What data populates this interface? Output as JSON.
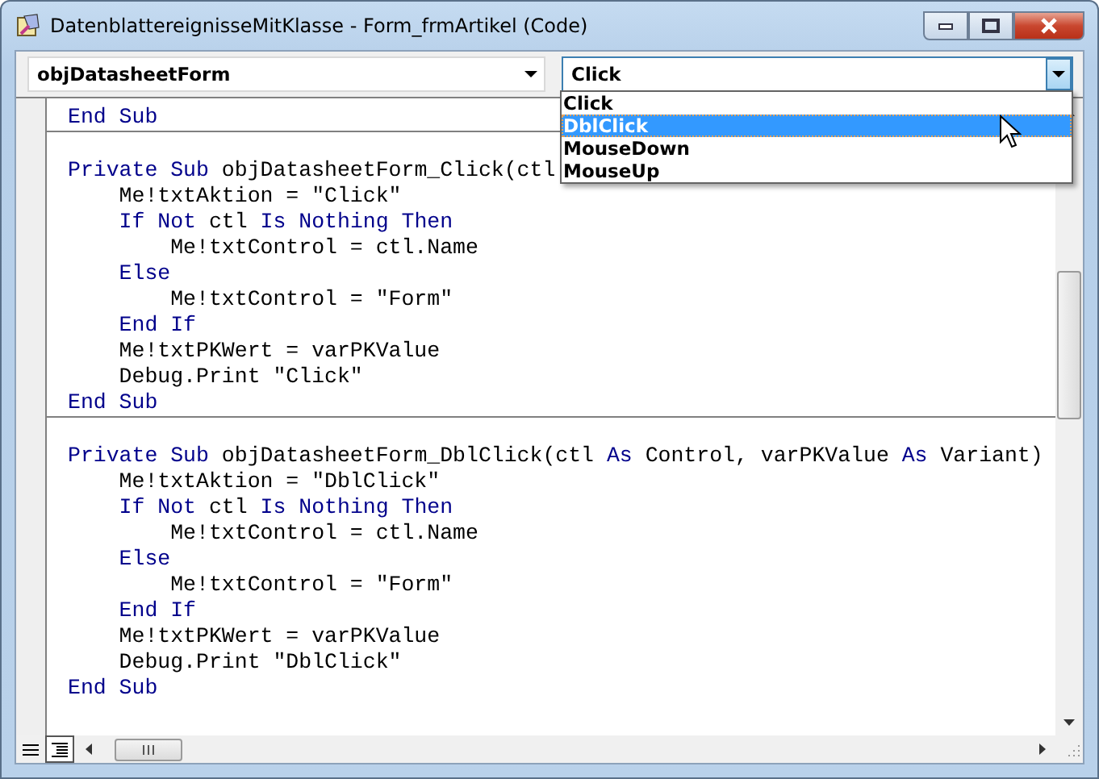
{
  "window": {
    "title": "DatenblattereignisseMitKlasse - Form_frmArtikel (Code)"
  },
  "object_combo": {
    "value": "objDatasheetForm"
  },
  "procedure_combo": {
    "value": "Click",
    "expanded": true,
    "options": [
      {
        "label": "Click",
        "highlighted": false
      },
      {
        "label": "DblClick",
        "highlighted": true
      },
      {
        "label": "MouseDown",
        "highlighted": false
      },
      {
        "label": "MouseUp",
        "highlighted": false
      }
    ]
  },
  "procedures": [
    {
      "lines": [
        [
          {
            "kind": "keyword",
            "text": "End Sub"
          }
        ]
      ]
    },
    {
      "lines": [
        [
          {
            "kind": "keyword",
            "text": "Private Sub"
          },
          {
            "kind": "plain",
            "text": " objDatasheetForm_Click(ctl"
          }
        ],
        [
          {
            "kind": "plain",
            "text": "    Me!txtAktion = \"Click\""
          }
        ],
        [
          {
            "kind": "keyword",
            "text": "    If Not"
          },
          {
            "kind": "plain",
            "text": " ctl "
          },
          {
            "kind": "keyword",
            "text": "Is Nothing Then"
          }
        ],
        [
          {
            "kind": "plain",
            "text": "        Me!txtControl = ctl.Name"
          }
        ],
        [
          {
            "kind": "keyword",
            "text": "    Else"
          }
        ],
        [
          {
            "kind": "plain",
            "text": "        Me!txtControl = \"Form\""
          }
        ],
        [
          {
            "kind": "keyword",
            "text": "    End If"
          }
        ],
        [
          {
            "kind": "plain",
            "text": "    Me!txtPKWert = varPKValue"
          }
        ],
        [
          {
            "kind": "plain",
            "text": "    Debug.Print \"Click\""
          }
        ],
        [
          {
            "kind": "keyword",
            "text": "End Sub"
          }
        ]
      ]
    },
    {
      "lines": [
        [
          {
            "kind": "keyword",
            "text": "Private Sub"
          },
          {
            "kind": "plain",
            "text": " objDatasheetForm_DblClick(ctl "
          },
          {
            "kind": "keyword",
            "text": "As"
          },
          {
            "kind": "plain",
            "text": " Control, varPKValue "
          },
          {
            "kind": "keyword",
            "text": "As"
          },
          {
            "kind": "plain",
            "text": " Variant)"
          }
        ],
        [
          {
            "kind": "plain",
            "text": "    Me!txtAktion = \"DblClick\""
          }
        ],
        [
          {
            "kind": "keyword",
            "text": "    If Not"
          },
          {
            "kind": "plain",
            "text": " ctl "
          },
          {
            "kind": "keyword",
            "text": "Is Nothing Then"
          }
        ],
        [
          {
            "kind": "plain",
            "text": "        Me!txtControl = ctl.Name"
          }
        ],
        [
          {
            "kind": "keyword",
            "text": "    Else"
          }
        ],
        [
          {
            "kind": "plain",
            "text": "        Me!txtControl = \"Form\""
          }
        ],
        [
          {
            "kind": "keyword",
            "text": "    End If"
          }
        ],
        [
          {
            "kind": "plain",
            "text": "    Me!txtPKWert = varPKValue"
          }
        ],
        [
          {
            "kind": "plain",
            "text": "    Debug.Print \"DblClick\""
          }
        ],
        [
          {
            "kind": "keyword",
            "text": "End Sub"
          }
        ]
      ]
    }
  ]
}
